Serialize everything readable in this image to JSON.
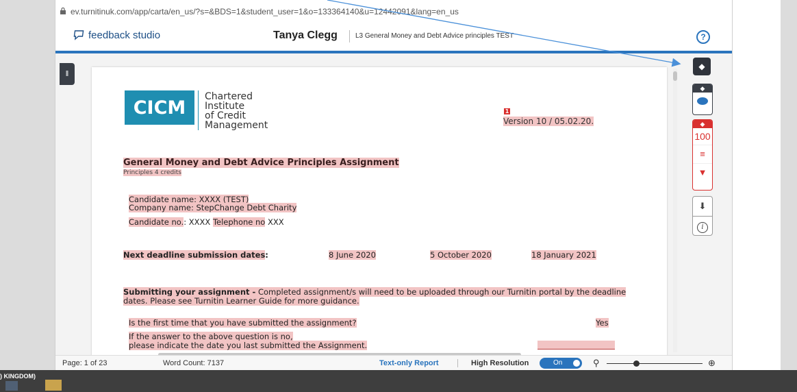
{
  "browser": {
    "url": "ev.turnitinuk.com/app/carta/en_us/?s=&BDS=1&student_user=1&o=133364140&u=12442091&lang=en_us"
  },
  "header": {
    "brand": "feedback studio",
    "student_name": "Tanya Clegg",
    "assignment_title": "L3 General Money and Debt Advice principles TEST",
    "help_label": "?"
  },
  "document": {
    "logo": {
      "mark": "CICM",
      "lines": [
        "Chartered",
        "Institute",
        "of Credit",
        "Management"
      ]
    },
    "marker": "1",
    "version": "Version 10 / 05.02.20.",
    "heading": "General Money and Debt Advice Principles Assignment",
    "subheading": "Principles 4 credits",
    "candidate_name_label": "Candidate name",
    "candidate_name_value": ": XXXX  (TEST)",
    "company_line": "Company name: StepChange Debt Charity",
    "candidate_no_label": "Candidate no.",
    "candidate_no_value": ": XXXX ",
    "telephone_label": "Telephone no",
    "telephone_value": " XXX",
    "deadline_label": "Next deadline submission dates",
    "deadline_colon": ":",
    "deadline_dates": [
      "8 June 2020",
      "5 October 2020",
      "18  January  2021"
    ],
    "submitting_label": "Submitting your assignment -",
    "submitting_text": " Completed assignment/s will need to be uploaded through our Turnitin portal by the deadline dates. Please see Turnitin Learner Guide for more guidance.",
    "question_first": "Is the first time that you have submitted the assignment?",
    "question_first_answer": "Yes",
    "question_if_no": "If the answer to the above question is no,",
    "question_date": "please indicate the date you last submitted the Assignment."
  },
  "side_panel": {
    "similarity_score": "100"
  },
  "statusbar": {
    "page": "Page: 1 of 23",
    "word_count": "Word Count: 7137",
    "text_only": "Text-only Report",
    "high_resolution": "High Resolution",
    "toggle_state": "On"
  },
  "taskbar": {
    "locale_label": ") KINGDOM)"
  },
  "colors": {
    "turnitin_blue": "#2a74bd",
    "match_red": "#d9302f",
    "highlight_pink": "#f2c4c4",
    "cicm_teal": "#1f8eb1",
    "panel_dark": "#3a3f47"
  },
  "icons": [
    "lock-icon",
    "feedback-studio-logo-icon",
    "help-icon",
    "layers-icon",
    "comment-bubble-icon",
    "filter-icon",
    "sort-icon",
    "download-icon",
    "info-icon",
    "zoom-out-icon",
    "zoom-in-icon"
  ]
}
